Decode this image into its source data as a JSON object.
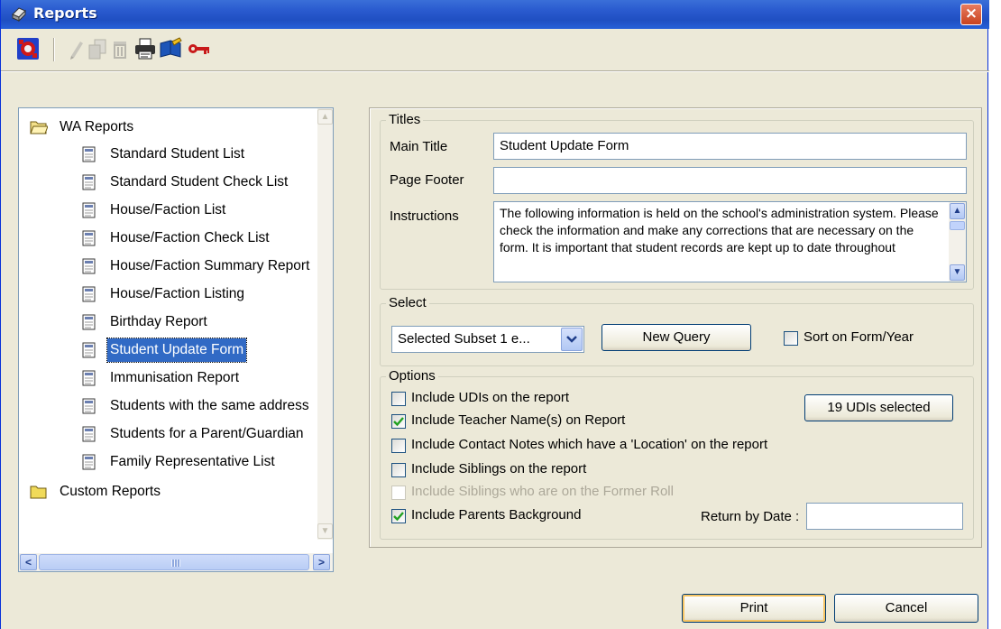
{
  "window": {
    "title": "Reports",
    "close_label": "×"
  },
  "toolbar": {
    "buttons": [
      "run-report-icon",
      "edit-icon",
      "copy-icon",
      "delete-icon",
      "print-icon",
      "notes-icon",
      "key-icon"
    ]
  },
  "tree": {
    "root_label": "WA Reports",
    "items": [
      "Standard Student List",
      "Standard Student Check List",
      "House/Faction List",
      "House/Faction Check List",
      "House/Faction Summary Report",
      "House/Faction Listing",
      "Birthday Report",
      "Student Update Form",
      "Immunisation Report",
      "Students with the same address",
      "Students for a Parent/Guardian",
      "Family Representative List"
    ],
    "selected_index": 7,
    "custom_label": "Custom Reports"
  },
  "titles": {
    "legend": "Titles",
    "main_title_label": "Main Title",
    "main_title_value": "Student Update Form",
    "page_footer_label": "Page Footer",
    "page_footer_value": "",
    "instructions_label": "Instructions",
    "instructions_value": "The following information is held  on the school's administration system.  Please check the information and make any corrections that are necessary on the form.  It is important that student records are kept up to date throughout"
  },
  "select": {
    "legend": "Select",
    "subset_value": "Selected Subset 1 e...",
    "new_query_label": "New Query",
    "sort_label": "Sort on Form/Year",
    "sort_checked": false
  },
  "options": {
    "legend": "Options",
    "include_udis": "Include UDIs on the report",
    "include_teacher": "Include Teacher Name(s) on Report",
    "include_contact_notes": "Include Contact Notes which have a 'Location' on the report",
    "include_siblings": "Include Siblings on the report",
    "include_former_siblings": "Include Siblings who are on the Former Roll",
    "include_parents_background": "Include Parents Background",
    "udis_button_label": "19 UDIs selected",
    "return_by_label": "Return by Date :",
    "return_by_value": ""
  },
  "footer": {
    "print_label": "Print",
    "cancel_label": "Cancel"
  },
  "colors": {
    "title_bar": "#2a5bcf",
    "selection": "#316ac5",
    "dialog_bg": "#ece9d8"
  }
}
